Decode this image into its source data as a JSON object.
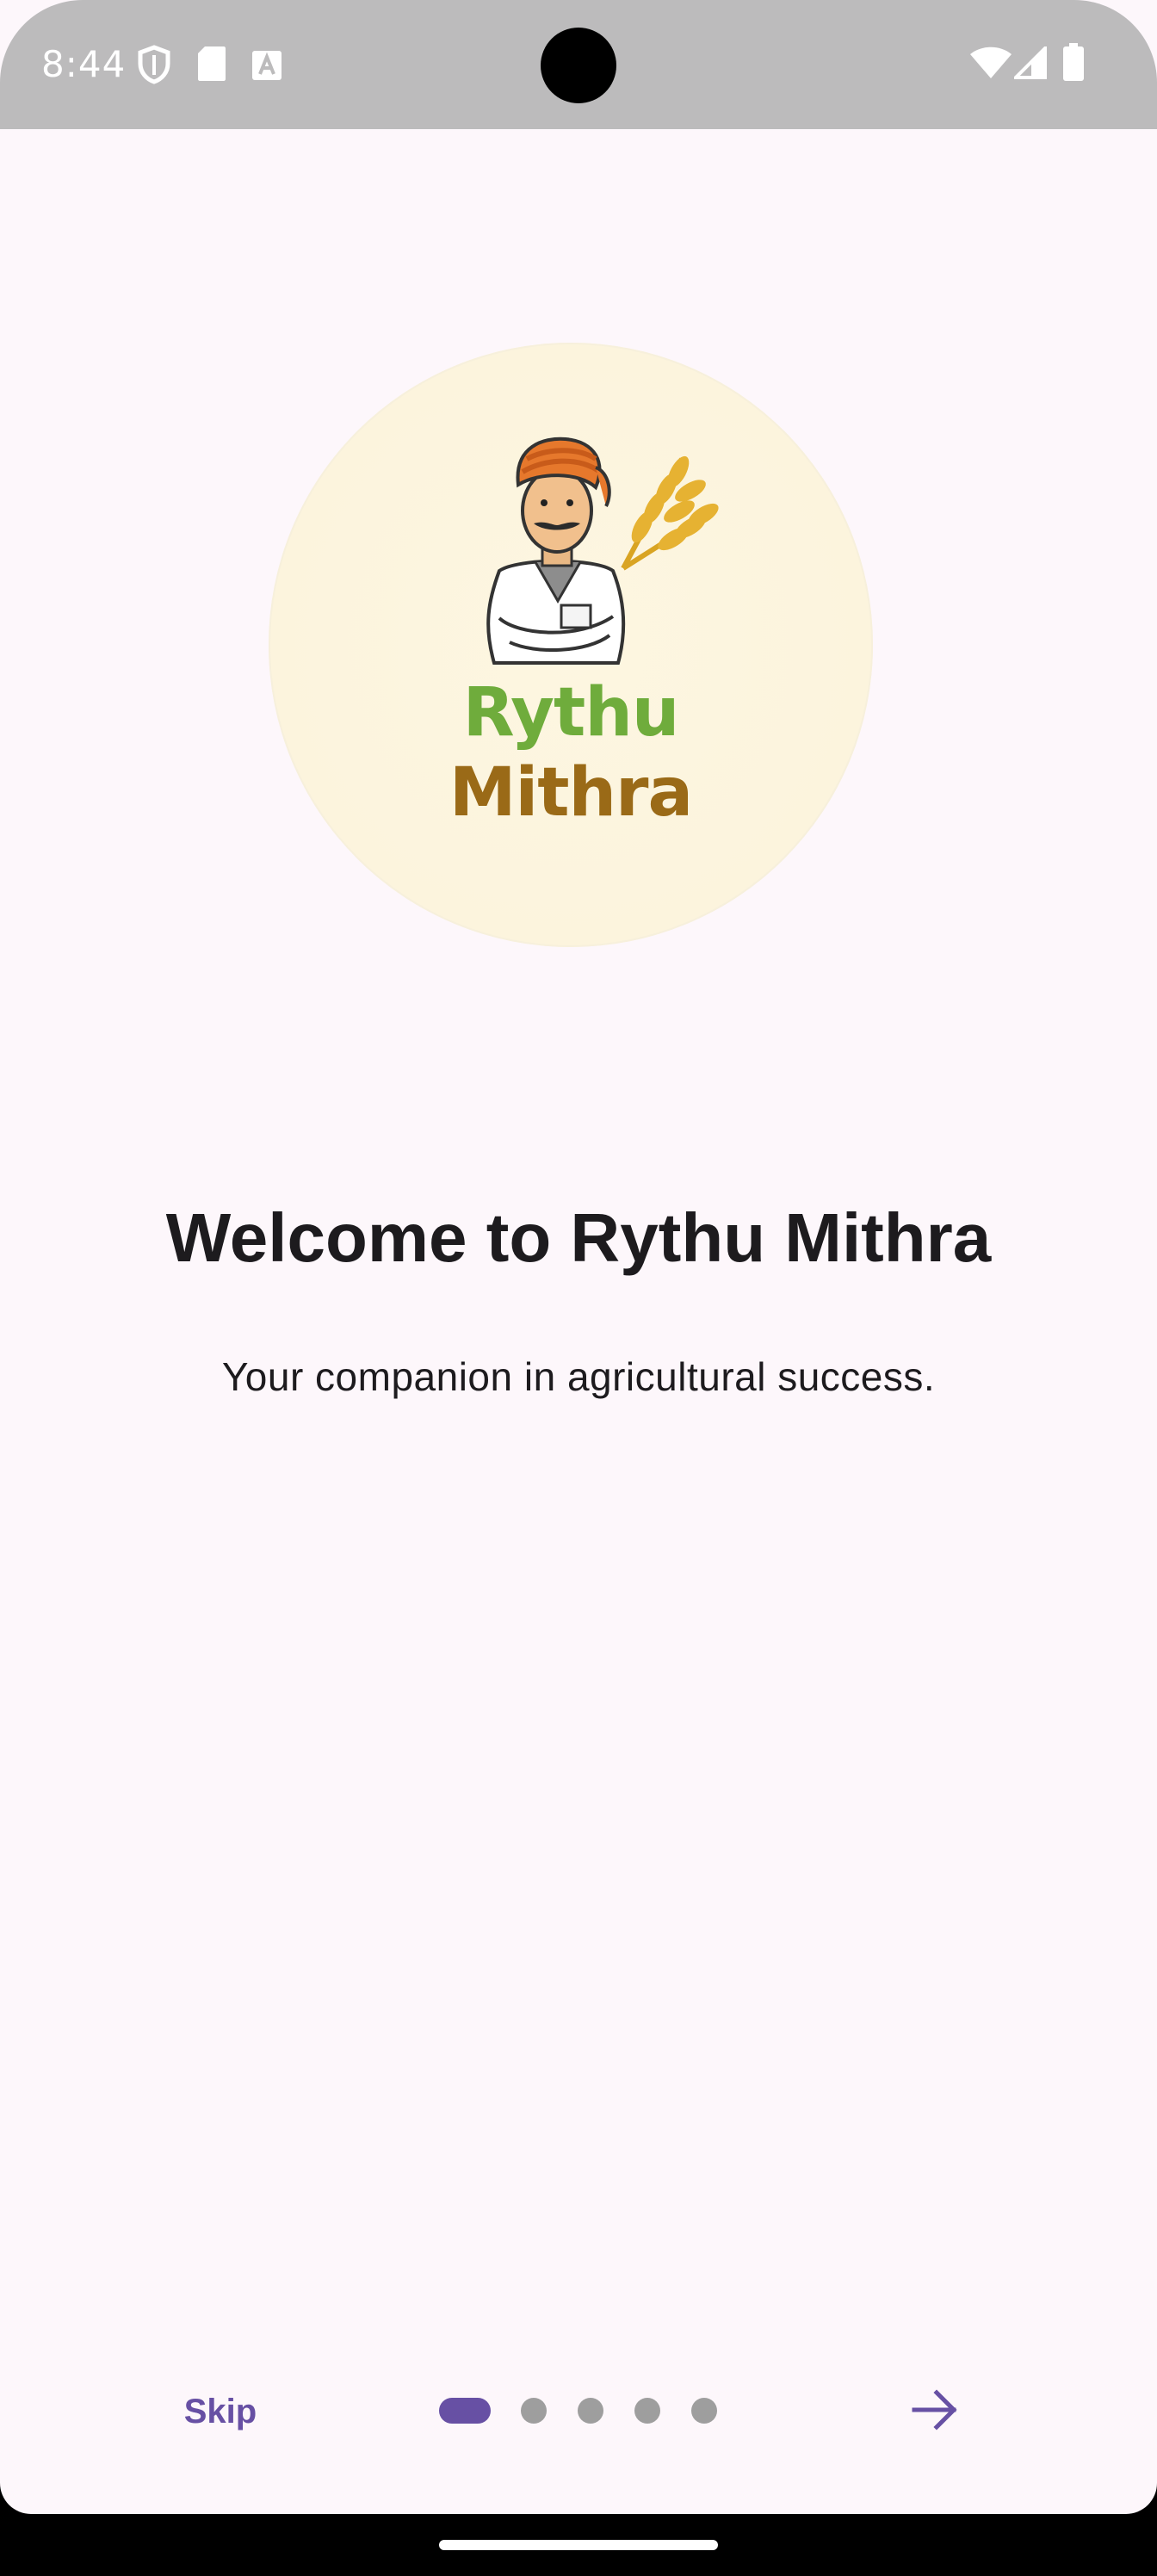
{
  "status_bar": {
    "time": "8:44",
    "icons_left": [
      "shield-icon",
      "sd-card-icon",
      "font-icon"
    ],
    "icons_right": [
      "wifi-icon",
      "signal-icon",
      "battery-icon"
    ]
  },
  "logo": {
    "line1": "Rythu",
    "line2": "Mithra"
  },
  "onboarding": {
    "title": "Welcome to Rythu Mithra",
    "subtitle": "Your companion in agricultural success."
  },
  "nav": {
    "skip_label": "Skip",
    "page_count": 5,
    "current_page": 1
  },
  "colors": {
    "accent": "#6750a4",
    "background": "#fdf7fb",
    "dot_inactive": "#9e9e9e",
    "status_bar": "#bcbbbc"
  }
}
